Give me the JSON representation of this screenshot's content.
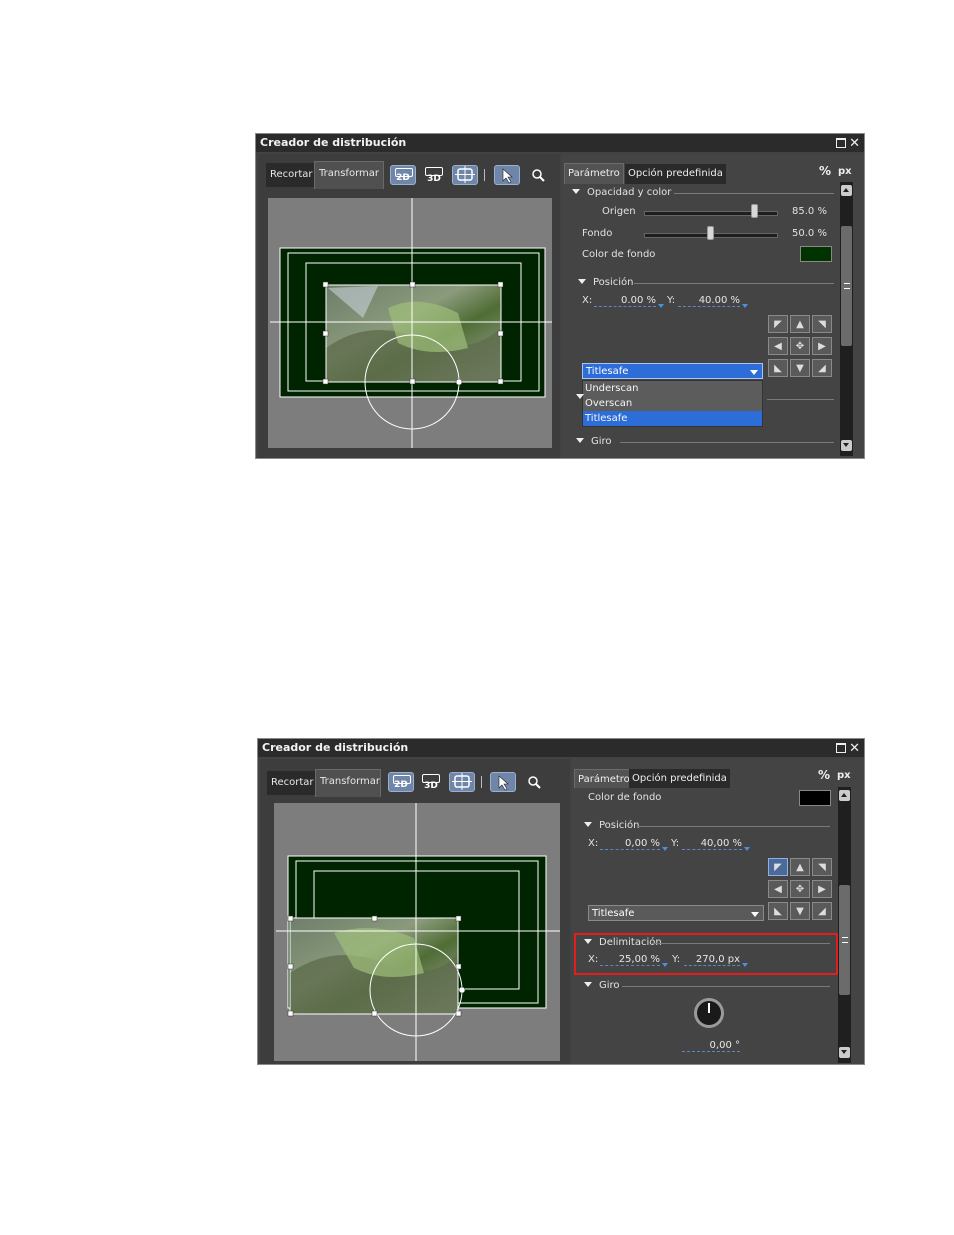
{
  "colors": {
    "canvas_bg": "#7d7d7d",
    "frame_dark": "#002400",
    "accent_blue": "#2d6dd8",
    "highlight": "#e11d1d"
  },
  "panel1": {
    "title": "Creador de distribución",
    "tabs": [
      "Recortar",
      "Transformar"
    ],
    "active_tab": "Transformar",
    "toolbar": {
      "btn_2d": "2D",
      "btn_3d": "3D",
      "icons": [
        "2d-mode-icon",
        "3d-mode-icon",
        "fit-frame-icon",
        "pointer-icon",
        "zoom-icon"
      ]
    },
    "right_tabs": [
      "Parámetro",
      "Opción predefinida"
    ],
    "unit_pct": "%",
    "unit_px": "px",
    "opacity": {
      "header": "Opacidad y color",
      "origen_label": "Origen",
      "origen_value": "85.0 %",
      "origen_level": 0.85,
      "fondo_label": "Fondo",
      "fondo_value": "50.0 %",
      "fondo_level": 0.5,
      "bgcolor_label": "Color de fondo",
      "bgcolor_swatch": "#003300"
    },
    "position": {
      "header": "Posición",
      "x_label": "X:",
      "x_value": "0.00 %",
      "y_label": "Y:",
      "y_value": "40.00 %"
    },
    "dropdown": {
      "selected": "Titlesafe",
      "options": [
        "Underscan",
        "Overscan",
        "Titlesafe"
      ]
    },
    "giro": {
      "header": "Giro"
    }
  },
  "panel2": {
    "title": "Creador de distribución",
    "tabs": [
      "Recortar",
      "Transformar"
    ],
    "active_tab": "Transformar",
    "toolbar": {
      "btn_2d": "2D",
      "btn_3d": "3D"
    },
    "right_tabs": [
      "Parámetro",
      "Opción predefinida"
    ],
    "unit_pct": "%",
    "unit_px": "px",
    "bgcolor_label": "Color de fondo",
    "bgcolor_swatch": "#000000",
    "position": {
      "header": "Posición",
      "x_label": "X:",
      "x_value": "0,00 %",
      "y_label": "Y:",
      "y_value": "40,00 %"
    },
    "dropdown": {
      "selected": "Titlesafe"
    },
    "delimitacion": {
      "header": "Delimitación",
      "x_label": "X:",
      "x_value": "25,00 %",
      "y_label": "Y:",
      "y_value": "270,0 px"
    },
    "giro": {
      "header": "Giro",
      "value": "0,00 °"
    }
  }
}
